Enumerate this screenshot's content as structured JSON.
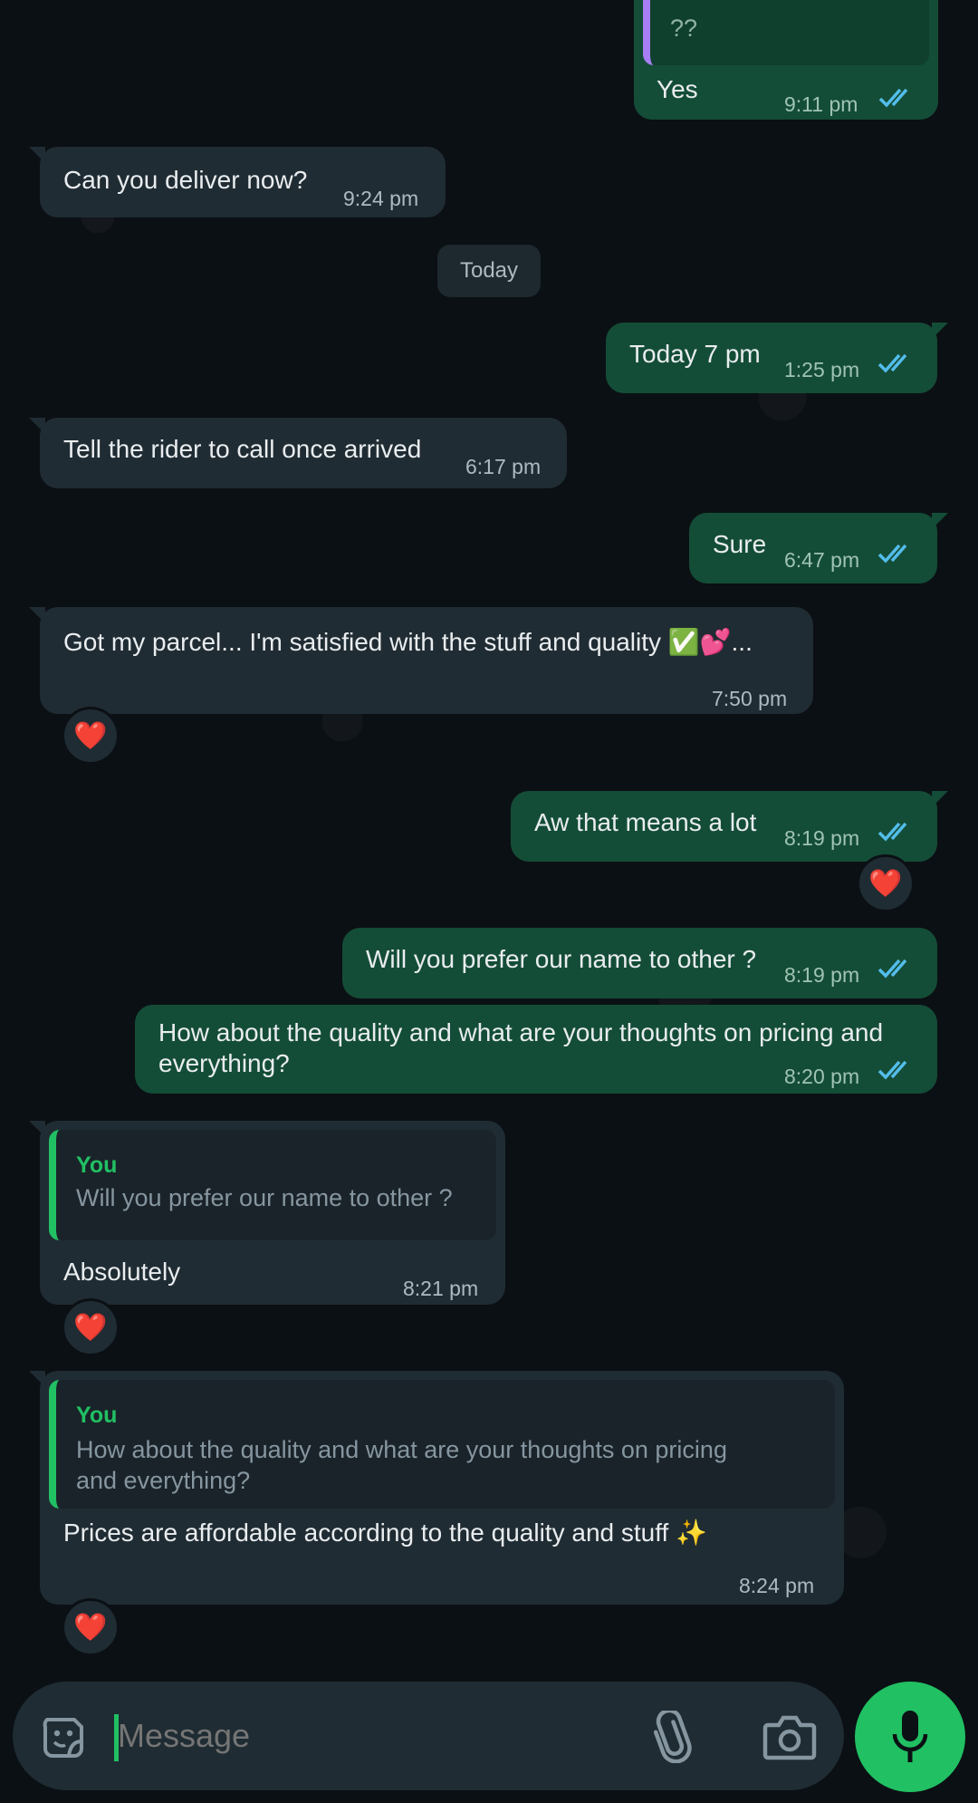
{
  "colors": {
    "background": "#0b1014",
    "incoming_bubble": "#202c33",
    "outgoing_bubble": "#144d37",
    "accent_green": "#21c063",
    "read_ticks": "#53bdeb",
    "quote_bar_purple": "#a77ff2"
  },
  "top_partial": {
    "quote_text": "??",
    "reply_text": "Yes",
    "time": "9:11 pm"
  },
  "messages": [
    {
      "dir": "in",
      "text": "Can you deliver now?",
      "time": "9:24 pm"
    },
    {
      "dir": "date",
      "text": "Today"
    },
    {
      "dir": "out",
      "text": "Today 7 pm",
      "time": "1:25 pm"
    },
    {
      "dir": "in",
      "text": "Tell the rider to call once arrived",
      "time": "6:17 pm"
    },
    {
      "dir": "out",
      "text": "Sure",
      "time": "6:47 pm"
    },
    {
      "dir": "in",
      "text": "Got my parcel... I'm satisfied with the stuff and quality ✅💕...",
      "time": "7:50 pm",
      "reaction": "❤️"
    },
    {
      "dir": "out",
      "text": "Aw that means a lot",
      "time": "8:19 pm",
      "reaction": "❤️"
    },
    {
      "dir": "out",
      "text": "Will you prefer our name to other ?",
      "time": "8:19 pm"
    },
    {
      "dir": "out",
      "text_line1": "How about the quality and what are your thoughts on pricing and",
      "text_line2": "everything?",
      "time": "8:20 pm"
    },
    {
      "dir": "in",
      "quote_author": "You",
      "quote_text": "Will you prefer our name to other ?",
      "text": "Absolutely",
      "time": "8:21 pm",
      "reaction": "❤️"
    },
    {
      "dir": "in",
      "quote_author": "You",
      "quote_text_line1": "How about the quality and what are your thoughts on pricing",
      "quote_text_line2": "and everything?",
      "text": "Prices are affordable according to the quality and stuff ✨",
      "time": "8:24 pm",
      "reaction": "❤️"
    }
  ],
  "composer": {
    "placeholder": "Message",
    "icons": [
      "sticker-icon",
      "paperclip-icon",
      "camera-icon",
      "microphone-icon"
    ]
  }
}
